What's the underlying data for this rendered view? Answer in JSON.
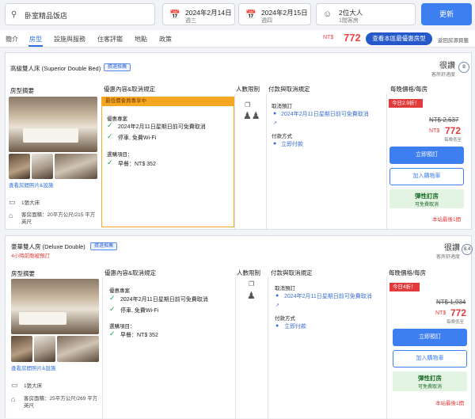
{
  "search": {
    "hotel": "卧室精品饭店",
    "checkin_date": "2024年2月14日",
    "checkin_day": "週三",
    "checkout_date": "2024年2月15日",
    "checkout_day": "週四",
    "guests": "2位大人",
    "rooms": "1間客房",
    "update": "更新"
  },
  "nav": {
    "tabs": [
      "簡介",
      "房型",
      "設施與服務",
      "住客評鑑",
      "地點",
      "政策"
    ],
    "price_from": "NT$",
    "price": "772",
    "best_btn": "查看本區最優惠房型",
    "back": "返回房源頁籤"
  },
  "rooms": [
    {
      "name": "高級雙人床 (Superior Double Bed)",
      "badge": "猜選推薦",
      "rating_word": "很讚",
      "rating_sub": "客房舒適度",
      "score": "8",
      "col_summary": "房型摘要",
      "col_benefits": "優惠內容&取消規定",
      "col_people": "人數限制",
      "col_cancel": "付款與取消規定",
      "col_price": "每晚價格/每房",
      "member_banner": "最低價會員專享中",
      "benefits_title": "優惠專案",
      "benefit1": "2024年2月11日星期日前可免費取消",
      "benefit2": "停車, 免費Wi-Fi",
      "extras_title": "選購項目：",
      "extra1": "早餐：NT$ 352",
      "cancel_title": "取消預訂",
      "cancel_text": "2024年2月11日星期日前可免費取消",
      "pay_title": "付款方式",
      "pay_text": "立即付款",
      "photos_link": "查看房間照片&設施",
      "bed": "1張大床",
      "area": "客房面積：20平方公尺/215 平方英尺",
      "deal": "今日2.9折！",
      "orig": "NT$ 2,637",
      "cur": "NT$",
      "price": "772",
      "lowest": "每晚低至",
      "book": "立即預訂",
      "cart": "加入購物車",
      "flex_a": "彈性訂房",
      "flex_b": "可免費取消",
      "last": "本站最後1間"
    },
    {
      "name": "豪華雙人房 (Deluxe Double)",
      "badge": "猜選推薦",
      "urgent": "4小時前剛被預訂",
      "rating_word": "很讚",
      "rating_sub": "客房舒適度",
      "score": "8.4",
      "col_summary": "房型摘要",
      "col_benefits": "優惠內容&取消規定",
      "col_people": "人數限制",
      "col_cancel": "付款與取消規定",
      "col_price": "每晚價格/每房",
      "benefits_title": "優惠專案",
      "benefit1": "2024年2月11日星期日前可免費取消",
      "benefit2": "停車, 免費Wi-Fi",
      "extras_title": "選購項目：",
      "extra1": "早餐：NT$ 352",
      "cancel_title": "取消預訂",
      "cancel_text": "2024年2月11日星期日前可免費取消",
      "pay_title": "付款方式",
      "pay_text": "立即付款",
      "photos_link": "查看房間照片&設施",
      "bed": "1張大床",
      "area": "客房面積：25平方公尺/269 平方英尺",
      "deal": "今日4折！",
      "orig": "NT$ 1,934",
      "cur": "NT$",
      "price": "772",
      "lowest": "每晚低至",
      "book": "立即預訂",
      "cart": "加入購物車",
      "flex_a": "彈性訂房",
      "flex_b": "可免費取消",
      "last": "本站最後1間"
    }
  ],
  "colors": {
    "accent": "#3d7ef0",
    "price": "#e23b3b",
    "member": "#f5a623"
  }
}
